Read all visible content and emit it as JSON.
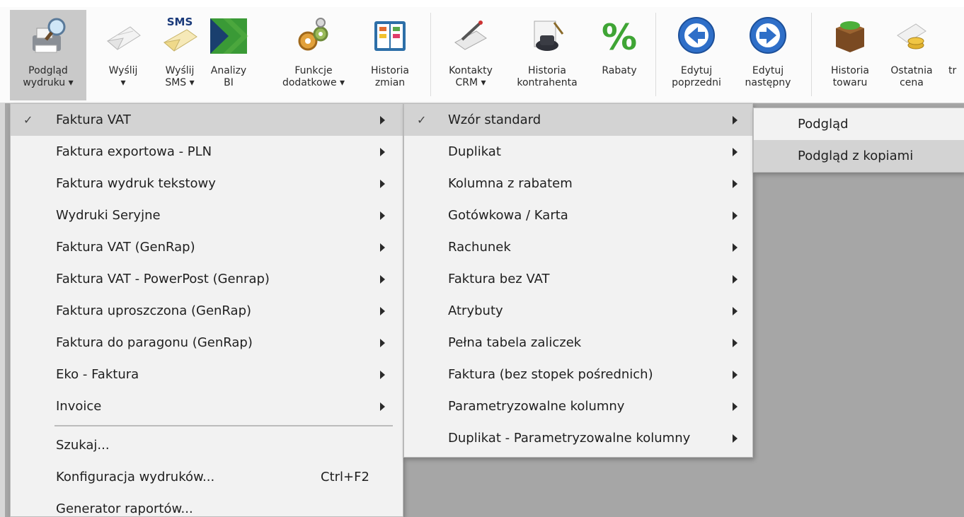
{
  "ribbon": {
    "buttons": [
      {
        "id": "podglad",
        "line1": "Podgląd",
        "line2": "wydruku ▾",
        "icon": "print-preview-icon"
      },
      {
        "id": "wyslij",
        "line1": "Wyślij",
        "line2": "▾",
        "icon": "send-envelope-icon"
      },
      {
        "id": "wyslij-sms",
        "line1": "Wyślij",
        "line2": "SMS ▾",
        "icon": "sms-envelope-icon",
        "badge": "SMS"
      },
      {
        "id": "analizy",
        "line1": "Analizy",
        "line2": "BI",
        "icon": "analytics-arrow-icon"
      },
      {
        "id": "funkcje",
        "line1": "Funkcje",
        "line2": "dodatkowe ▾",
        "icon": "gears-icon"
      },
      {
        "id": "historia-zmian",
        "line1": "Historia",
        "line2": "zmian",
        "icon": "history-book-icon"
      },
      {
        "id": "kontakty",
        "line1": "Kontakty",
        "line2": "CRM ▾",
        "icon": "crm-contacts-icon"
      },
      {
        "id": "historia-kontrahenta",
        "line1": "Historia",
        "line2": "kontrahenta",
        "icon": "contractor-history-icon"
      },
      {
        "id": "rabaty",
        "line1": "Rabaty",
        "line2": "",
        "icon": "percent-icon"
      },
      {
        "id": "edytuj-poprzedni",
        "line1": "Edytuj",
        "line2": "poprzedni",
        "icon": "arrow-left-circle-icon"
      },
      {
        "id": "edytuj-nastepny",
        "line1": "Edytuj",
        "line2": "następny",
        "icon": "arrow-right-circle-icon"
      },
      {
        "id": "historia-towaru",
        "line1": "Historia",
        "line2": "towaru",
        "icon": "product-box-icon"
      },
      {
        "id": "ostatnia-cena",
        "line1": "Ostatnia",
        "line2": "cena",
        "icon": "price-coins-icon"
      },
      {
        "id": "partial",
        "line1": "",
        "line2": "tr",
        "icon": "cut-off-icon"
      }
    ]
  },
  "menu1": {
    "items": [
      {
        "label": "Faktura VAT",
        "checked": "✓"
      },
      {
        "label": "Faktura exportowa - PLN"
      },
      {
        "label": "Faktura wydruk tekstowy"
      },
      {
        "label": "Wydruki Seryjne"
      },
      {
        "label": "Faktura VAT (GenRap)"
      },
      {
        "label": "Faktura VAT - PowerPost (Genrap)"
      },
      {
        "label": "Faktura uproszczona (GenRap)"
      },
      {
        "label": "Faktura do paragonu (GenRap)"
      },
      {
        "label": "Eko - Faktura"
      },
      {
        "label": "Invoice"
      }
    ],
    "actions": [
      {
        "label": "Szukaj..."
      },
      {
        "label": "Konfiguracja wydruków...",
        "shortcut": "Ctrl+F2"
      },
      {
        "label": "Generator raportów..."
      }
    ]
  },
  "menu2": {
    "items": [
      {
        "label": "Wzór standard",
        "checked": "✓"
      },
      {
        "label": "Duplikat"
      },
      {
        "label": "Kolumna z rabatem"
      },
      {
        "label": "Gotówkowa / Karta"
      },
      {
        "label": "Rachunek"
      },
      {
        "label": "Faktura bez VAT"
      },
      {
        "label": "Atrybuty"
      },
      {
        "label": "Pełna tabela zaliczek"
      },
      {
        "label": "Faktura (bez stopek pośrednich)"
      },
      {
        "label": "Parametryzowalne kolumny"
      },
      {
        "label": "Duplikat - Parametryzowalne kolumny"
      }
    ]
  },
  "menu3": {
    "items": [
      {
        "label": "Podgląd"
      },
      {
        "label": "Podgląd z kopiami"
      }
    ]
  }
}
